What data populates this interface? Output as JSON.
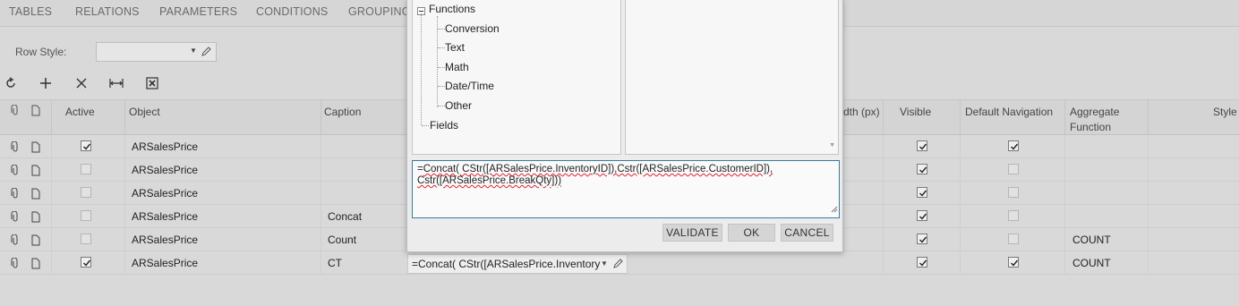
{
  "tabs": [
    "TABLES",
    "RELATIONS",
    "PARAMETERS",
    "CONDITIONS",
    "GROUPING"
  ],
  "row_style": {
    "label": "Row Style:",
    "value": ""
  },
  "toolbar": [
    "refresh-icon",
    "add-icon",
    "delete-icon",
    "fit-columns-icon",
    "export-excel-icon"
  ],
  "grid": {
    "headers": {
      "active": "Active",
      "object": "Object",
      "caption": "Caption",
      "width": "dth (px)",
      "visible": "Visible",
      "default_nav": "Default Navigation",
      "aggregate_line1": "Aggregate",
      "aggregate_line2": "Function",
      "style": "Style"
    },
    "rows": [
      {
        "active": true,
        "object": "ARSalesPrice",
        "caption": "",
        "visible": true,
        "default_nav": true,
        "aggregate": ""
      },
      {
        "active": false,
        "object": "ARSalesPrice",
        "caption": "",
        "visible": true,
        "default_nav": false,
        "aggregate": ""
      },
      {
        "active": false,
        "object": "ARSalesPrice",
        "caption": "",
        "visible": true,
        "default_nav": false,
        "aggregate": ""
      },
      {
        "active": false,
        "object": "ARSalesPrice",
        "caption": "Concat",
        "visible": true,
        "default_nav": false,
        "aggregate": ""
      },
      {
        "active": false,
        "object": "ARSalesPrice",
        "caption": "Count",
        "visible": true,
        "default_nav": false,
        "aggregate": "COUNT"
      },
      {
        "active": true,
        "object": "ARSalesPrice",
        "caption": "CT",
        "visible": true,
        "default_nav": true,
        "aggregate": "COUNT"
      }
    ],
    "editing_value": "=Concat( CStr([ARSalesPrice.Inventory"
  },
  "dialog": {
    "tree": {
      "root": "Functions",
      "children": [
        "Conversion",
        "Text",
        "Math",
        "Date/Time",
        "Other"
      ],
      "fields": "Fields"
    },
    "expression": {
      "line1": "=Concat( CStr([ARSalesPrice.InventoryID]),Cstr([ARSalesPrice.CustomerID]),",
      "line2": "Cstr([ARSalesPrice.BreakQty]))"
    },
    "buttons": {
      "validate": "VALIDATE",
      "ok": "OK",
      "cancel": "CANCEL"
    }
  }
}
